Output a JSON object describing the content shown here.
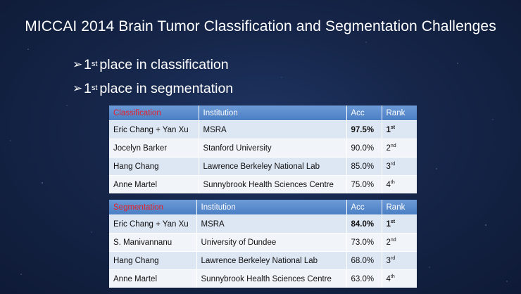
{
  "slide": {
    "title": "MICCAI 2014 Brain Tumor Classification and Segmentation Challenges",
    "bullets": [
      {
        "prefix": "1",
        "sup": "st",
        "text": "place in classification"
      },
      {
        "prefix": "1",
        "sup": "st",
        "text": "place in segmentation"
      }
    ]
  },
  "classification_table": {
    "headers": [
      "Classification",
      "Institution",
      "Acc",
      "Rank"
    ],
    "rows": [
      {
        "name": "Eric Chang + Yan Xu",
        "institution": "MSRA",
        "acc": "97.5%",
        "rank": "1",
        "rank_sup": "st"
      },
      {
        "name": "Jocelyn Barker",
        "institution": "Stanford University",
        "acc": "90.0%",
        "rank": "2",
        "rank_sup": "nd"
      },
      {
        "name": "Hang Chang",
        "institution": "Lawrence Berkeley National Lab",
        "acc": "85.0%",
        "rank": "3",
        "rank_sup": "rd"
      },
      {
        "name": "Anne Martel",
        "institution": "Sunnybrook Health Sciences Centre",
        "acc": "75.0%",
        "rank": "4",
        "rank_sup": "th"
      }
    ]
  },
  "segmentation_table": {
    "headers": [
      "Segmentation",
      "Institution",
      "Acc",
      "Rank"
    ],
    "rows": [
      {
        "name": "Eric Chang + Yan Xu",
        "institution": "MSRA",
        "acc": "84.0%",
        "rank": "1",
        "rank_sup": "st"
      },
      {
        "name": "S. Manivannanu",
        "institution": "University of Dundee",
        "acc": "73.0%",
        "rank": "2",
        "rank_sup": "nd"
      },
      {
        "name": "Hang Chang",
        "institution": "Lawrence Berkeley National Lab",
        "acc": "68.0%",
        "rank": "3",
        "rank_sup": "rd"
      },
      {
        "name": "Anne Martel",
        "institution": "Sunnybrook Health Sciences Centre",
        "acc": "63.0%",
        "rank": "4",
        "rank_sup": "th"
      }
    ]
  },
  "icons": {
    "bullet": "arrow-bullet-icon"
  },
  "colors": {
    "header_red": "#e4222a",
    "header_blue": "#4a7ec4",
    "background": "#16264a"
  }
}
